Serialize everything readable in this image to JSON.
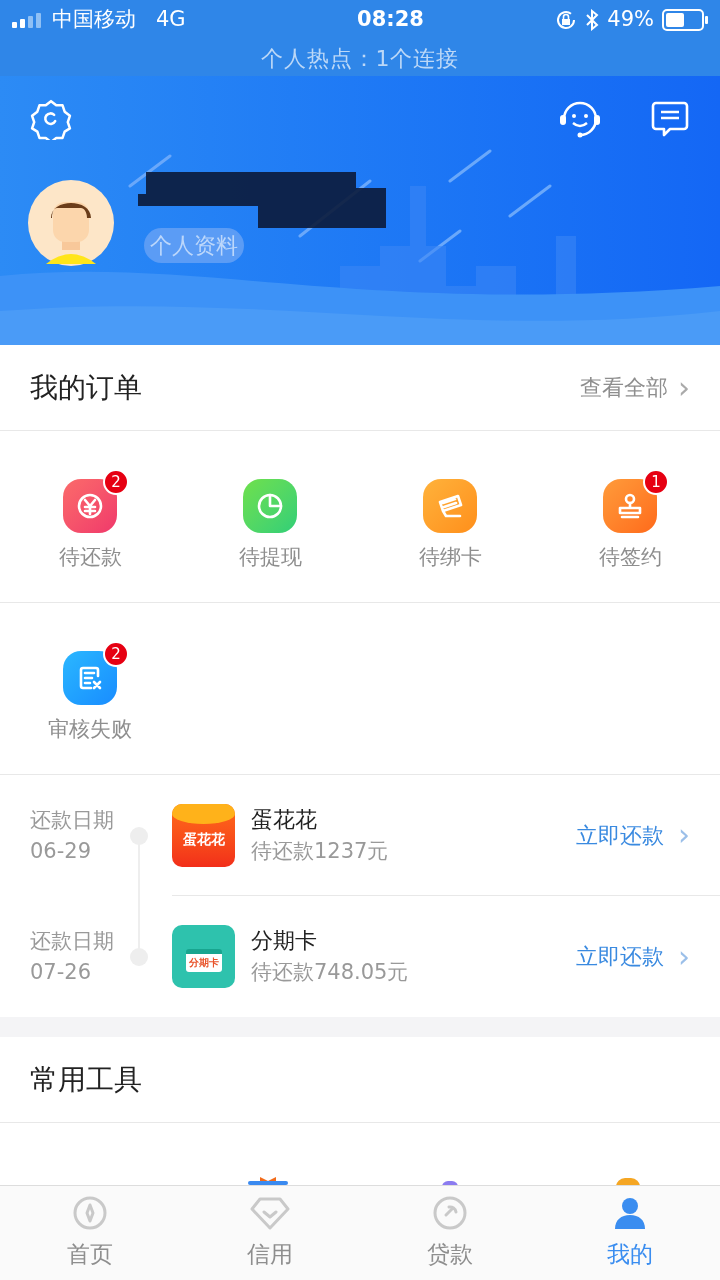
{
  "status_bar": {
    "carrier": "中国移动",
    "network": "4G",
    "time": "08:28",
    "battery": "49%",
    "hotspot": "个人热点：1个连接"
  },
  "profile": {
    "link": "个人资料"
  },
  "orders": {
    "title": "我的订单",
    "view_all": "查看全部",
    "more": "›",
    "items": [
      {
        "label": "待还款",
        "kind": "repay",
        "badge": "2"
      },
      {
        "label": "待提现",
        "kind": "withdraw"
      },
      {
        "label": "待绑卡",
        "kind": "card"
      },
      {
        "label": "待签约",
        "kind": "sign",
        "badge": "1"
      },
      {
        "label": "审核失败",
        "kind": "failed",
        "badge": "2"
      }
    ]
  },
  "repayments": [
    {
      "date_label": "还款日期",
      "date": "06-29",
      "name": "蛋花花",
      "logo": "蛋花花",
      "kind": "egg",
      "amount": "待还款1237元",
      "action": "立即还款",
      "more": "›"
    },
    {
      "date_label": "还款日期",
      "date": "07-26",
      "name": "分期卡",
      "logo": "分期卡",
      "kind": "card",
      "amount": "待还款748.05元",
      "action": "立即还款",
      "more": "›"
    }
  ],
  "tools": {
    "title": "常用工具"
  },
  "tab_bar": [
    {
      "label": "首页",
      "kind": "home",
      "selected": false
    },
    {
      "label": "信用",
      "kind": "credit",
      "selected": false
    },
    {
      "label": "贷款",
      "kind": "loan",
      "selected": false
    },
    {
      "label": "我的",
      "kind": "me",
      "selected": true
    }
  ]
}
